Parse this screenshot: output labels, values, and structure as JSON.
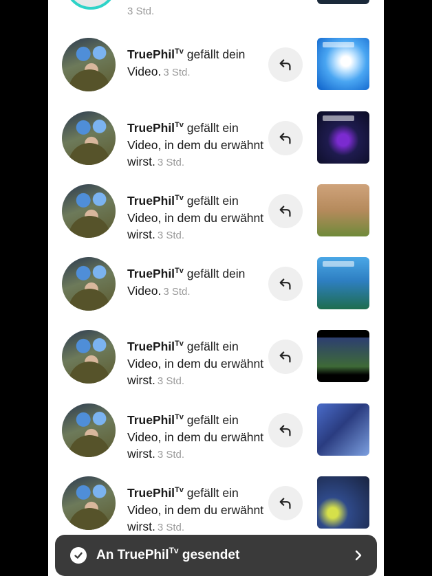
{
  "top_item": {
    "time": "3 Std."
  },
  "notifications": [
    {
      "user": "TruePhil",
      "user_sup": "Tv",
      "action": "gefällt dein Video.",
      "time": "3 Std.",
      "thumb_icon": "video-thumbnail"
    },
    {
      "user": "TruePhil",
      "user_sup": "Tv",
      "action": "gefällt ein Video, in dem du erwähnt wirst.",
      "time": "3 Std.",
      "thumb_icon": "video-thumbnail"
    },
    {
      "user": "TruePhil",
      "user_sup": "Tv",
      "action": "gefällt ein Video, in dem du erwähnt wirst.",
      "time": "3 Std.",
      "thumb_icon": "video-thumbnail"
    },
    {
      "user": "TruePhil",
      "user_sup": "Tv",
      "action": "gefällt dein Video.",
      "time": "3 Std.",
      "thumb_icon": "video-thumbnail"
    },
    {
      "user": "TruePhil",
      "user_sup": "Tv",
      "action": "gefällt ein Video, in dem du erwähnt wirst.",
      "time": "3 Std.",
      "thumb_icon": "video-thumbnail"
    },
    {
      "user": "TruePhil",
      "user_sup": "Tv",
      "action": "gefällt ein Video, in dem du erwähnt wirst.",
      "time": "3 Std.",
      "thumb_icon": "video-thumbnail"
    },
    {
      "user": "TruePhil",
      "user_sup": "Tv",
      "action": "gefällt ein Video, in dem du erwähnt wirst.",
      "time": "3 Std.",
      "thumb_icon": "video-thumbnail"
    }
  ],
  "toast": {
    "prefix": "An ",
    "user": "TruePhil",
    "user_sup": "Tv",
    "suffix": " gesendet",
    "icon": "check-circle-icon",
    "arrow_icon": "chevron-right-icon"
  },
  "colors": {
    "accent_ring": "#2ed3c8",
    "toast_bg": "#3a3a3a",
    "reply_bg": "#efefef"
  }
}
